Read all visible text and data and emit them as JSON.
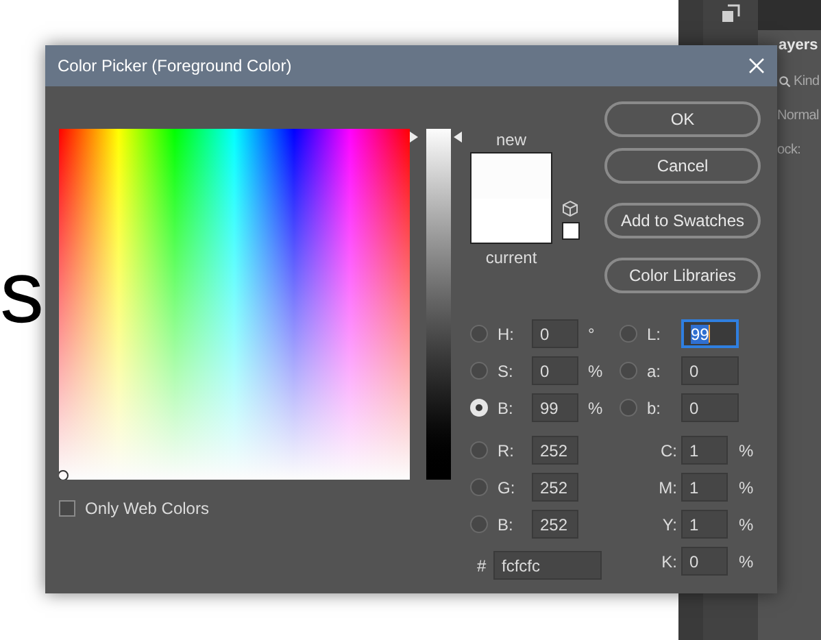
{
  "canvas": {
    "text": "s"
  },
  "panel": {
    "tab": "ayers",
    "search": "Kind",
    "blend_mode": "Normal",
    "lock": "ock:"
  },
  "dialog": {
    "title": "Color Picker (Foreground Color)",
    "slider": {
      "level": 0.99
    },
    "only_web_colors": {
      "label": "Only Web Colors",
      "checked": false
    },
    "new_label": "new",
    "current_label": "current",
    "buttons": [
      {
        "label": "OK"
      },
      {
        "label": "Cancel"
      },
      {
        "label": "Add to Swatches"
      },
      {
        "label": "Color Libraries"
      }
    ],
    "hsb": [
      {
        "label": "H:",
        "value": "0",
        "unit": "°",
        "selected": false
      },
      {
        "label": "S:",
        "value": "0",
        "unit": "%",
        "selected": false
      },
      {
        "label": "B:",
        "value": "99",
        "unit": "%",
        "selected": true
      }
    ],
    "rgb": [
      {
        "label": "R:",
        "value": "252",
        "selected": false
      },
      {
        "label": "G:",
        "value": "252",
        "selected": false
      },
      {
        "label": "B:",
        "value": "252",
        "selected": false
      }
    ],
    "hex": {
      "label": "#",
      "value": "fcfcfc"
    },
    "lab": [
      {
        "label": "L:",
        "value": "99",
        "selected": false,
        "focused": true
      },
      {
        "label": "a:",
        "value": "0",
        "selected": false,
        "focused": false
      },
      {
        "label": "b:",
        "value": "0",
        "selected": false,
        "focused": false
      }
    ],
    "cmyk": [
      {
        "label": "C:",
        "value": "1",
        "unit": "%"
      },
      {
        "label": "M:",
        "value": "1",
        "unit": "%"
      },
      {
        "label": "Y:",
        "value": "1",
        "unit": "%"
      },
      {
        "label": "K:",
        "value": "0",
        "unit": "%"
      }
    ]
  }
}
